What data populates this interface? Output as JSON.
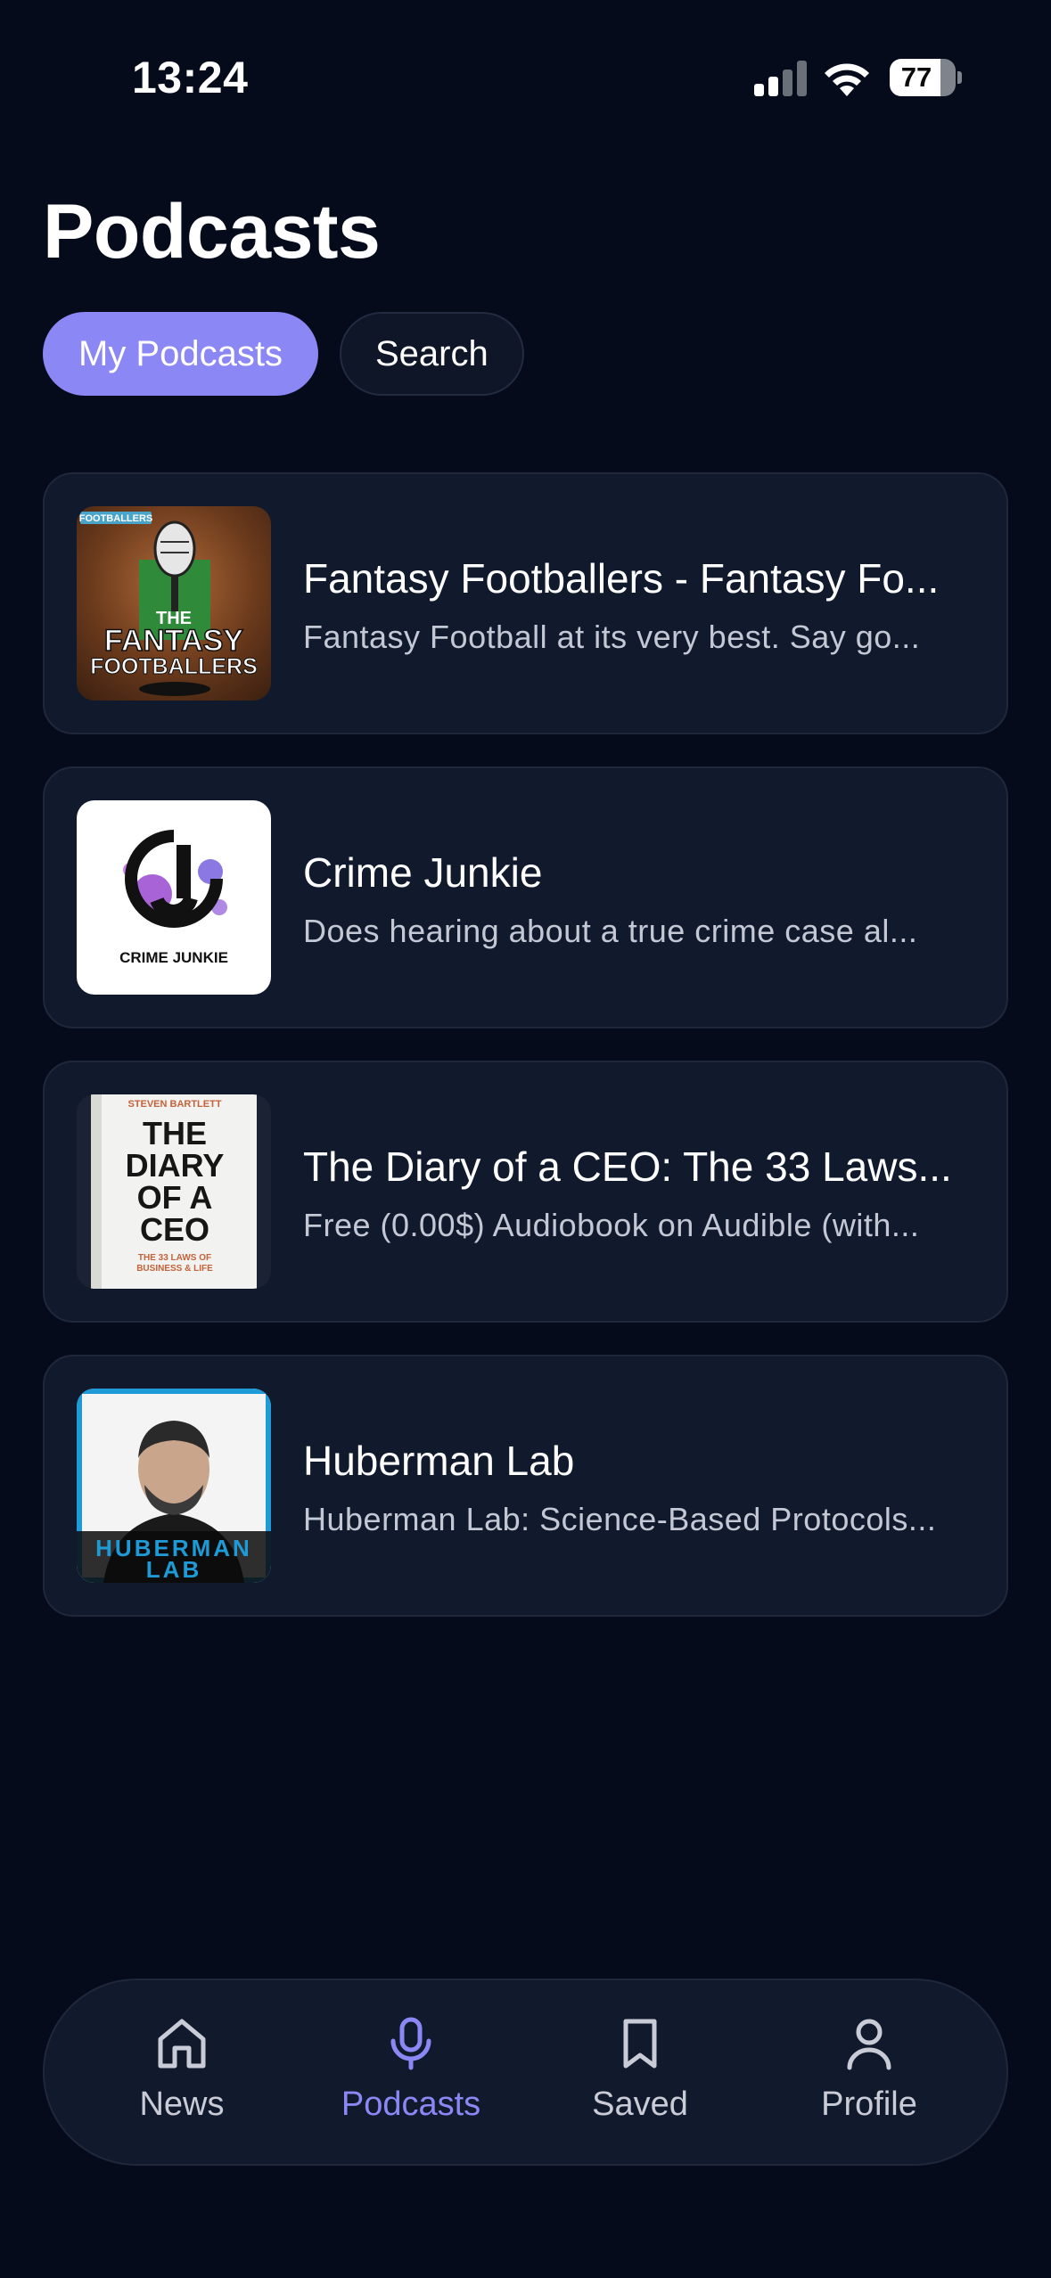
{
  "status_bar": {
    "time": "13:24",
    "battery": "77",
    "battery_level": 0.77
  },
  "header": {
    "title": "Podcasts"
  },
  "segments": [
    {
      "label": "My Podcasts",
      "active": true
    },
    {
      "label": "Search",
      "active": false
    }
  ],
  "podcasts": [
    {
      "title": "Fantasy Footballers - Fantasy Fo...",
      "description": "Fantasy Football at its very best. Say go...",
      "cover_text": [
        "FOOTBALLERS",
        "THE",
        "FANTASY",
        "FOOTBALLERS"
      ]
    },
    {
      "title": "Crime Junkie",
      "description": "Does hearing about a true crime case al...",
      "cover_text": [
        "CRIME JUNKIE"
      ]
    },
    {
      "title": "The Diary of a CEO: The 33 Laws...",
      "description": "Free (0.00$) Audiobook on Audible (with...",
      "cover_text": [
        "STEVEN BARTLETT",
        "THE",
        "DIARY",
        "OF A",
        "CEO",
        "THE 33 LAWS OF",
        "BUSINESS & LIFE"
      ]
    },
    {
      "title": "Huberman Lab",
      "description": "Huberman Lab: Science-Based Protocols...",
      "cover_text": [
        "HUBERMAN",
        "LAB"
      ]
    }
  ],
  "bottom_nav": [
    {
      "label": "News",
      "icon": "home-icon",
      "active": false
    },
    {
      "label": "Podcasts",
      "icon": "microphone-icon",
      "active": true
    },
    {
      "label": "Saved",
      "icon": "bookmark-icon",
      "active": false
    },
    {
      "label": "Profile",
      "icon": "person-icon",
      "active": false
    }
  ],
  "colors": {
    "background": "#050b1a",
    "card": "#111a2d",
    "accent": "#8b87f5",
    "muted_text": "#c3c8d4"
  }
}
